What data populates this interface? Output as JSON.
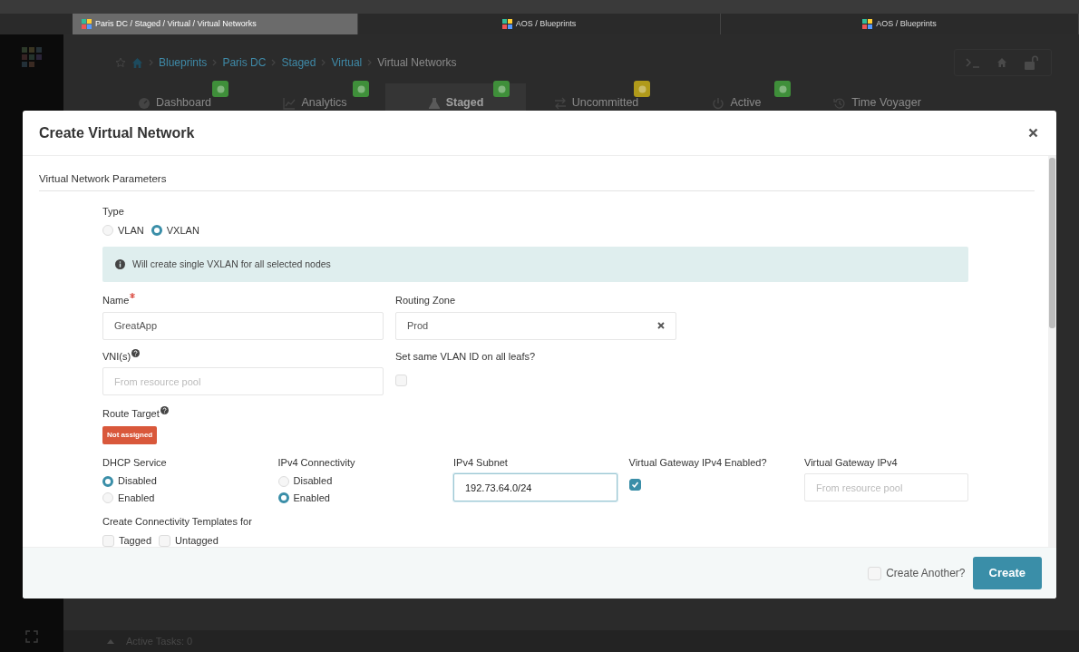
{
  "browser_tabs": [
    {
      "title": "Paris DC / Staged / Virtual / Virtual Networks",
      "selected": true
    },
    {
      "title": "AOS / Blueprints",
      "selected": false
    },
    {
      "title": "AOS / Blueprints",
      "selected": false
    }
  ],
  "breadcrumb": [
    "Blueprints",
    "Paris DC",
    "Staged",
    "Virtual",
    "Virtual Networks"
  ],
  "nav_tabs": [
    {
      "label": "Dashboard",
      "selected": false,
      "color": "#3f8f3a"
    },
    {
      "label": "Analytics",
      "selected": false,
      "color": "#3f8f3a"
    },
    {
      "label": "Staged",
      "selected": true,
      "color": "#3f8f3a"
    },
    {
      "label": "Uncommitted",
      "selected": false,
      "color": "#b09a1a"
    },
    {
      "label": "Active",
      "selected": false,
      "color": "#3f8f3a"
    },
    {
      "label": "Time Voyager",
      "selected": false
    }
  ],
  "modal": {
    "title": "Create Virtual Network",
    "section": "Virtual Network Parameters",
    "type": {
      "label": "Type",
      "options": [
        {
          "label": "VLAN",
          "selected": false
        },
        {
          "label": "VXLAN",
          "selected": true
        }
      ]
    },
    "alert": "Will create single VXLAN for all selected nodes",
    "name": {
      "label": "Name",
      "required": true,
      "value": "GreatApp"
    },
    "routing_zone": {
      "label": "Routing Zone",
      "value": "Prod"
    },
    "vni": {
      "label": "VNI(s)",
      "help": true,
      "placeholder": "From resource pool"
    },
    "same_vlan": {
      "label": "Set same VLAN ID on all leafs?",
      "checked": false
    },
    "route_target": {
      "label": "Route Target",
      "help": true,
      "status": "Not assigned"
    },
    "dhcp": {
      "label": "DHCP Service",
      "options": [
        {
          "label": "Disabled",
          "selected": true
        },
        {
          "label": "Enabled",
          "selected": false
        }
      ]
    },
    "ipv4_connectivity": {
      "label": "IPv4 Connectivity",
      "options": [
        {
          "label": "Disabled",
          "selected": false
        },
        {
          "label": "Enabled",
          "selected": true
        }
      ]
    },
    "ipv4_subnet": {
      "label": "IPv4 Subnet",
      "value": "192.73.64.0/24",
      "focused": true
    },
    "vgw_enabled": {
      "label": "Virtual Gateway IPv4 Enabled?",
      "checked": true
    },
    "vgw_ipv4": {
      "label": "Virtual Gateway IPv4",
      "placeholder": "From resource pool"
    },
    "templates": {
      "label": "Create Connectivity Templates for",
      "options": [
        {
          "label": "Tagged",
          "checked": false
        },
        {
          "label": "Untagged",
          "checked": false
        }
      ]
    },
    "create_another": {
      "label": "Create Another?",
      "checked": false
    },
    "submit": "Create"
  },
  "status_bar": {
    "text": "Active Tasks: 0"
  }
}
